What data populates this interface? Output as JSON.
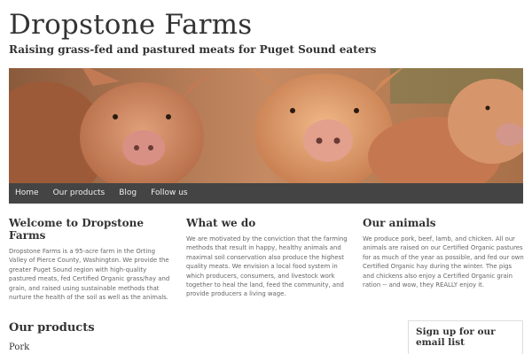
{
  "site": {
    "title": "Dropstone Farms",
    "tagline": "Raising grass-fed and pastured meats for Puget Sound eaters"
  },
  "hero": {
    "icon": "pigs-photo"
  },
  "nav": {
    "items": [
      {
        "label": "Home"
      },
      {
        "label": "Our products"
      },
      {
        "label": "Blog"
      },
      {
        "label": "Follow us"
      }
    ]
  },
  "columns": [
    {
      "heading": "Welcome to Dropstone Farms",
      "body": "Dropstone Farms is a 95-acre farm in the Orting Valley of Pierce County, Washington. We provide the greater Puget Sound region with high-quality pastured meats, fed Certified Organic grass/hay and grain, and raised using sustainable methods that nurture the health of the soil as well as the animals."
    },
    {
      "heading": "What we do",
      "body": "We are motivated by the conviction that the farming methods that result in happy, healthy animals and maximal soil conservation also produce the highest quality meats. We envision a local food system in which producers, consumers, and livestock work together to heal the land, feed the community, and provide producers a living wage."
    },
    {
      "heading": "Our animals",
      "body": "We produce pork, beef, lamb, and chicken. All our animals are raised on our Certified Organic pastures for as much of the year as possible, and fed our own Certified Organic hay during the winter. The pigs and chickens also enjoy a Certified Organic grain ration -- and wow, they REALLY enjoy it."
    }
  ],
  "products": {
    "heading": "Our products",
    "first_item": "Pork"
  },
  "signup": {
    "heading": "Sign up for our email list"
  }
}
